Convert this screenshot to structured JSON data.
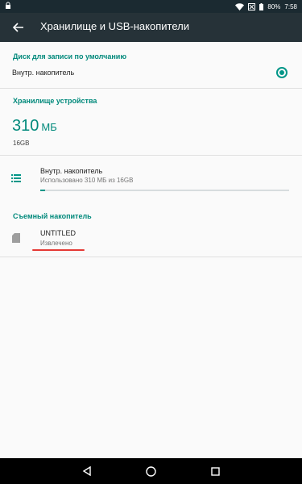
{
  "status_bar": {
    "battery": "80%",
    "time": "7:58",
    "icons": [
      "lock-icon",
      "wifi-icon",
      "signal-icon",
      "battery-icon"
    ]
  },
  "toolbar": {
    "title": "Хранилище и USB-накопители",
    "back_icon": "back-arrow-icon"
  },
  "default_disk": {
    "header": "Диск для записи по умолчанию",
    "option_label": "Внутр. накопитель",
    "selected": true
  },
  "device_storage": {
    "header": "Хранилище устройства",
    "used_value": "310",
    "used_unit": "МБ",
    "total": "16GB",
    "item": {
      "title": "Внутр. накопитель",
      "subtitle": "Использовано 310 МБ из 16GB",
      "usage_fraction": 0.02
    }
  },
  "removable": {
    "header": "Съемный накопитель",
    "item": {
      "title": "UNTITLED",
      "subtitle": "Извлечено"
    }
  },
  "colors": {
    "accent": "#009688",
    "toolbar": "#263238",
    "statusbar": "#1b2a31",
    "annotation": "#e53935"
  },
  "navbar": {
    "icons": [
      "back-triangle-icon",
      "home-circle-icon",
      "recents-square-icon"
    ]
  }
}
